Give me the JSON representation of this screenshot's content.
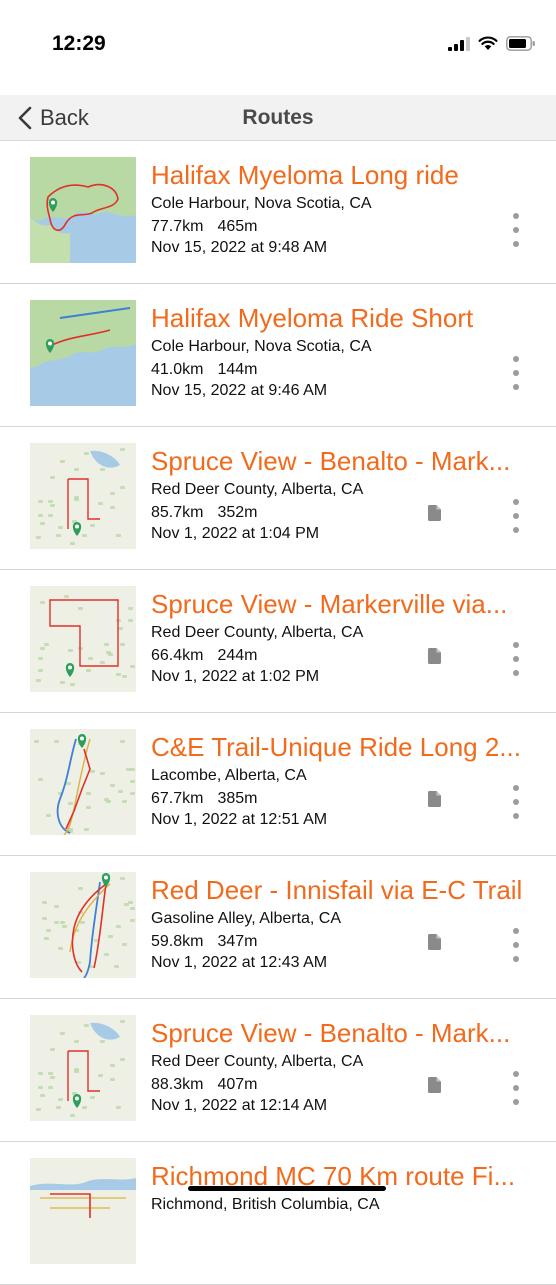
{
  "status_bar": {
    "time": "12:29"
  },
  "nav": {
    "back_label": "Back",
    "title": "Routes"
  },
  "routes": [
    {
      "name": "Halifax Myeloma Long ride",
      "location": "Cole Harbour, Nova Scotia, CA",
      "distance": "77.7km",
      "elevation": "465m",
      "date": "Nov 15, 2022 at 9:48 AM",
      "has_file": false,
      "thumb": "halifax-long"
    },
    {
      "name": "Halifax Myeloma Ride Short",
      "location": "Cole Harbour, Nova Scotia, CA",
      "distance": "41.0km",
      "elevation": "144m",
      "date": "Nov 15, 2022 at 9:46 AM",
      "has_file": false,
      "thumb": "halifax-short"
    },
    {
      "name": "Spruce View - Benalto - Mark...",
      "location": "Red Deer County, Alberta, CA",
      "distance": "85.7km",
      "elevation": "352m",
      "date": "Nov 1, 2022 at 1:04 PM",
      "has_file": true,
      "thumb": "spruce-a"
    },
    {
      "name": "Spruce View - Markerville via...",
      "location": "Red Deer County, Alberta, CA",
      "distance": "66.4km",
      "elevation": "244m",
      "date": "Nov 1, 2022 at 1:02 PM",
      "has_file": true,
      "thumb": "spruce-b"
    },
    {
      "name": "C&E Trail-Unique Ride Long 2...",
      "location": "Lacombe, Alberta, CA",
      "distance": "67.7km",
      "elevation": "385m",
      "date": "Nov 1, 2022 at 12:51 AM",
      "has_file": true,
      "thumb": "ce-trail"
    },
    {
      "name": "Red Deer - Innisfail via E-C Trail",
      "location": "Gasoline Alley, Alberta, CA",
      "distance": "59.8km",
      "elevation": "347m",
      "date": "Nov 1, 2022 at 12:43 AM",
      "has_file": true,
      "thumb": "red-deer"
    },
    {
      "name": "Spruce View - Benalto - Mark...",
      "location": "Red Deer County, Alberta, CA",
      "distance": "88.3km",
      "elevation": "407m",
      "date": "Nov 1, 2022 at 12:14 AM",
      "has_file": true,
      "thumb": "spruce-a"
    },
    {
      "name": "Richmond MC 70 Km route Fi...",
      "location": "Richmond, British Columbia, CA",
      "distance": "",
      "elevation": "",
      "date": "",
      "has_file": false,
      "thumb": "richmond"
    }
  ],
  "colors": {
    "accent": "#f26a1b",
    "route_line": "#e0302a",
    "pin": "#2e9e5b"
  },
  "icons": {
    "back": "chevron-left-icon",
    "more": "more-vertical-icon",
    "file": "file-icon"
  }
}
